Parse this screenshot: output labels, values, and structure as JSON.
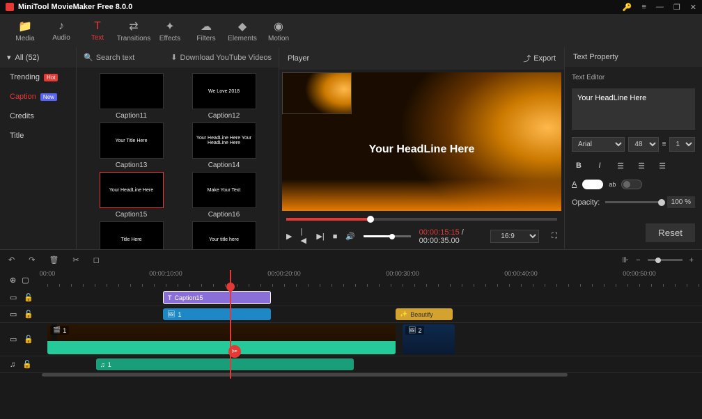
{
  "app_title": "MiniTool MovieMaker Free 8.0.0",
  "toolbar_tabs": [
    {
      "icon": "📁",
      "label": "Media"
    },
    {
      "icon": "♪",
      "label": "Audio"
    },
    {
      "icon": "T",
      "label": "Text"
    },
    {
      "icon": "⇄",
      "label": "Transitions"
    },
    {
      "icon": "✦",
      "label": "Effects"
    },
    {
      "icon": "☁",
      "label": "Filters"
    },
    {
      "icon": "◆",
      "label": "Elements"
    },
    {
      "icon": "◉",
      "label": "Motion"
    }
  ],
  "categories": {
    "all_label": "All (52)",
    "items": [
      {
        "label": "Trending",
        "badge": "Hot",
        "badge_class": "badge-hot"
      },
      {
        "label": "Caption",
        "badge": "New",
        "badge_class": "badge-new",
        "active": true
      },
      {
        "label": "Credits"
      },
      {
        "label": "Title"
      }
    ]
  },
  "gallery": {
    "search_label": "Search text",
    "download_label": "Download YouTube Videos",
    "items": [
      {
        "label": "Caption11",
        "thumb_text": ""
      },
      {
        "label": "Caption12",
        "thumb_text": "We Love 2018"
      },
      {
        "label": "Caption13",
        "thumb_text": "Your Title Here"
      },
      {
        "label": "Caption14",
        "thumb_text": "Your HeadLine Here\nYour HeadLine Here"
      },
      {
        "label": "Caption15",
        "thumb_text": "Your HeadLine Here",
        "selected": true
      },
      {
        "label": "Caption16",
        "thumb_text": "Make Your Text"
      },
      {
        "label": "",
        "thumb_text": "Title Here"
      },
      {
        "label": "",
        "thumb_text": "Your title here"
      }
    ]
  },
  "player": {
    "header": "Player",
    "export": "Export",
    "overlay_text": "Your HeadLine Here",
    "current_time": "00:00:15:15",
    "total_time": "00:00:35.00",
    "ratio": "16:9"
  },
  "property": {
    "header": "Text Property",
    "editor_label": "Text Editor",
    "editor_value": "Your HeadLine Here",
    "font": "Arial",
    "size": "48",
    "lineheight_icon": "≡",
    "lineheight": "1",
    "opacity_label": "Opacity:",
    "opacity_value": "100 %",
    "reset": "Reset"
  },
  "timeline": {
    "ruler": [
      "00:00",
      "00:00:10:00",
      "00:00:20:00",
      "00:00:30:00",
      "00:00:40:00",
      "00:00:50:00"
    ],
    "caption_clip": "Caption15",
    "pip_clip": "1",
    "beautify_clip": "Beautify",
    "video_clip": "1",
    "video2_clip": "2",
    "audio_clip": "1"
  }
}
